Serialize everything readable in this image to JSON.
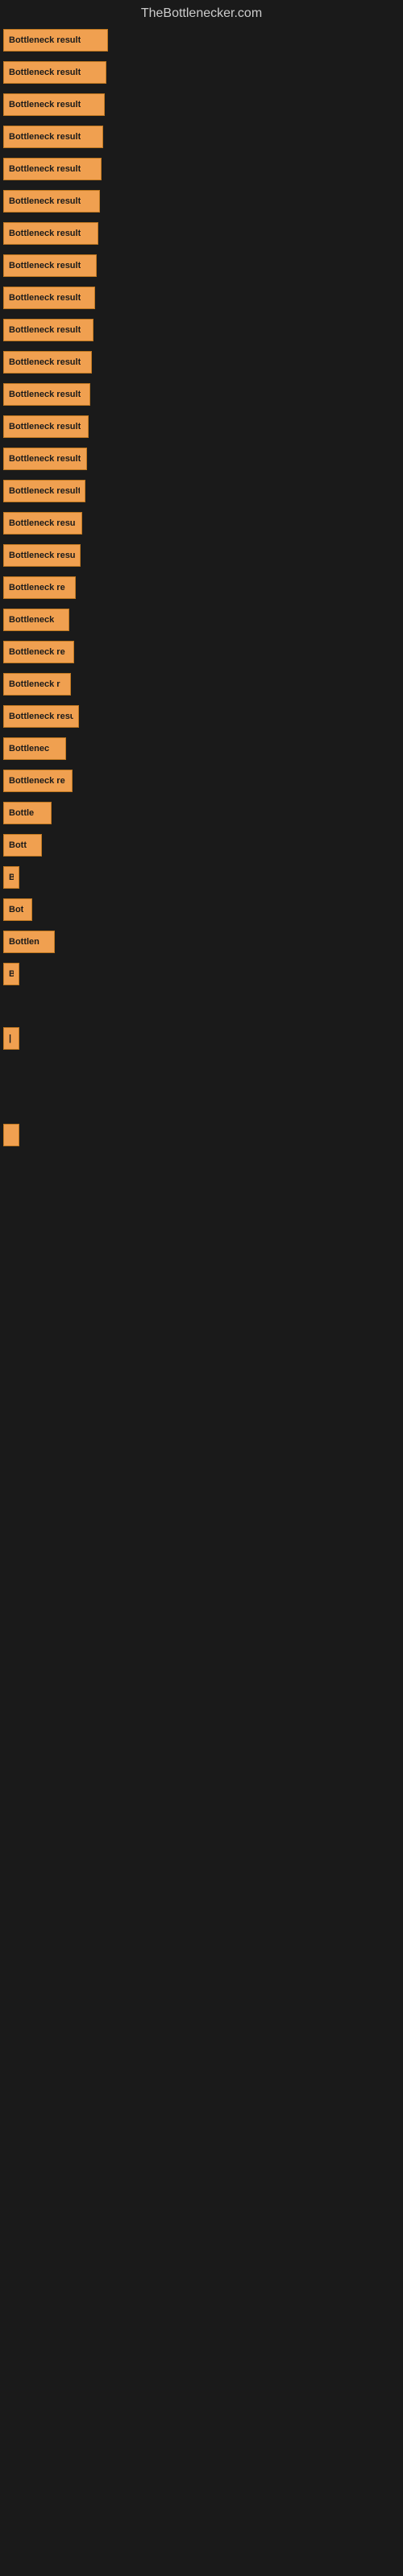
{
  "site": {
    "title": "TheBottlenecker.com"
  },
  "items": [
    {
      "label": "Bottleneck result",
      "width": 130
    },
    {
      "label": "Bottleneck result",
      "width": 128
    },
    {
      "label": "Bottleneck result",
      "width": 126
    },
    {
      "label": "Bottleneck result",
      "width": 124
    },
    {
      "label": "Bottleneck result",
      "width": 122
    },
    {
      "label": "Bottleneck result",
      "width": 120
    },
    {
      "label": "Bottleneck result",
      "width": 118
    },
    {
      "label": "Bottleneck result",
      "width": 116
    },
    {
      "label": "Bottleneck result",
      "width": 114
    },
    {
      "label": "Bottleneck result",
      "width": 112
    },
    {
      "label": "Bottleneck result",
      "width": 110
    },
    {
      "label": "Bottleneck result",
      "width": 108
    },
    {
      "label": "Bottleneck result",
      "width": 106
    },
    {
      "label": "Bottleneck result",
      "width": 104
    },
    {
      "label": "Bottleneck result",
      "width": 102
    },
    {
      "label": "Bottleneck resu",
      "width": 98
    },
    {
      "label": "Bottleneck result",
      "width": 96
    },
    {
      "label": "Bottleneck re",
      "width": 90
    },
    {
      "label": "Bottleneck",
      "width": 82
    },
    {
      "label": "Bottleneck re",
      "width": 88
    },
    {
      "label": "Bottleneck r",
      "width": 84
    },
    {
      "label": "Bottleneck resu",
      "width": 94
    },
    {
      "label": "Bottlenec",
      "width": 78
    },
    {
      "label": "Bottleneck re",
      "width": 86
    },
    {
      "label": "Bottle",
      "width": 60
    },
    {
      "label": "Bott",
      "width": 48
    },
    {
      "label": "B",
      "width": 20
    },
    {
      "label": "Bot",
      "width": 36
    },
    {
      "label": "Bottlen",
      "width": 64
    },
    {
      "label": "B",
      "width": 18
    },
    {
      "label": "",
      "width": 0
    },
    {
      "label": "",
      "width": 0
    },
    {
      "label": "|",
      "width": 8
    },
    {
      "label": "",
      "width": 0
    },
    {
      "label": "",
      "width": 0
    },
    {
      "label": "",
      "width": 0
    },
    {
      "label": "",
      "width": 0
    },
    {
      "label": "",
      "width": 6
    }
  ]
}
